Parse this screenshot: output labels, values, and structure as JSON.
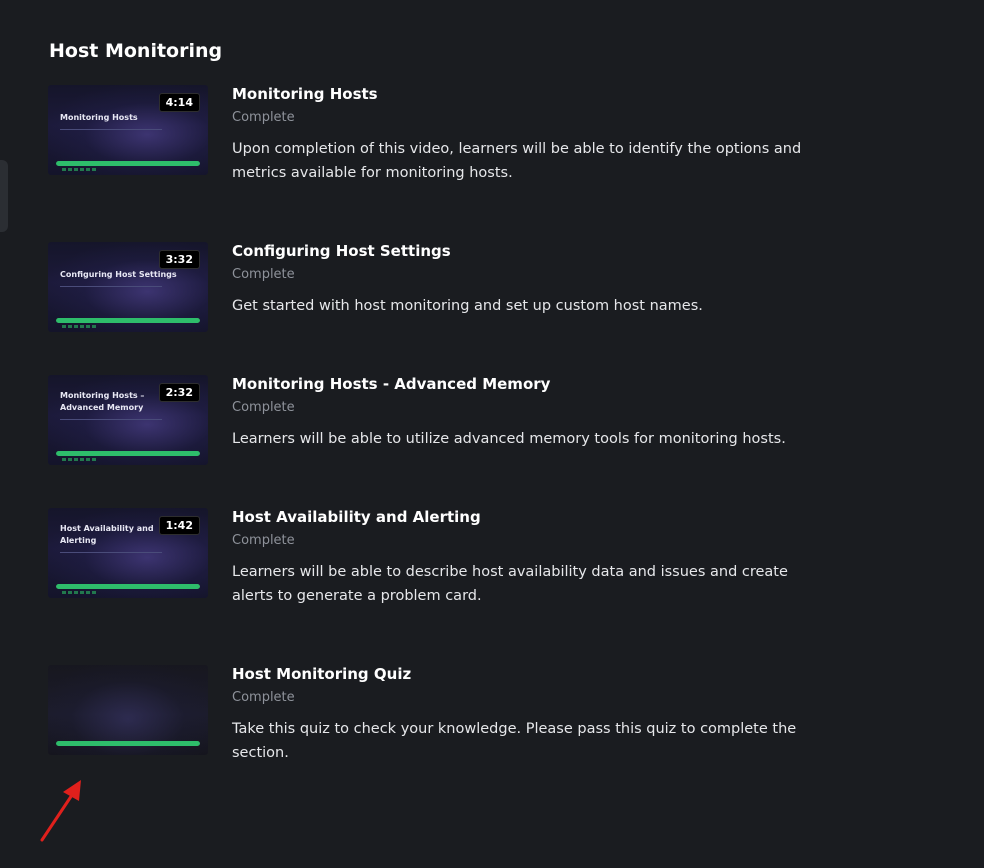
{
  "section": {
    "title": "Host Monitoring"
  },
  "lessons": [
    {
      "title": "Monitoring Hosts",
      "status": "Complete",
      "description": "Upon completion of this video, learners will be able to identify the options and metrics available for monitoring hosts.",
      "thumbnail_title": "Monitoring Hosts",
      "duration": "4:14",
      "progress": 1.0
    },
    {
      "title": "Configuring Host Settings",
      "status": "Complete",
      "description": "Get started with host monitoring and set up custom host names.",
      "thumbnail_title": "Configuring Host Settings",
      "duration": "3:32",
      "progress": 1.0
    },
    {
      "title": "Monitoring Hosts - Advanced Memory",
      "status": "Complete",
      "description": "Learners will be able to utilize advanced memory tools for monitoring hosts.",
      "thumbnail_title": "Monitoring Hosts – Advanced Memory",
      "duration": "2:32",
      "progress": 1.0
    },
    {
      "title": "Host Availability and Alerting",
      "status": "Complete",
      "description": "Learners will be able to describe host availability data and issues and create alerts to generate a problem card.",
      "thumbnail_title": "Host Availability and Alerting",
      "duration": "1:42",
      "progress": 1.0
    },
    {
      "title": "Host Monitoring Quiz",
      "status": "Complete",
      "description": "Take this quiz to check your knowledge. Please pass this quiz to complete the section.",
      "thumbnail_title": "",
      "duration": "",
      "progress": 1.0
    }
  ],
  "colors": {
    "background": "#1a1c20",
    "progress": "#2ebd6b",
    "status_text": "#8e929a",
    "annotation_arrow": "#e0201c"
  }
}
